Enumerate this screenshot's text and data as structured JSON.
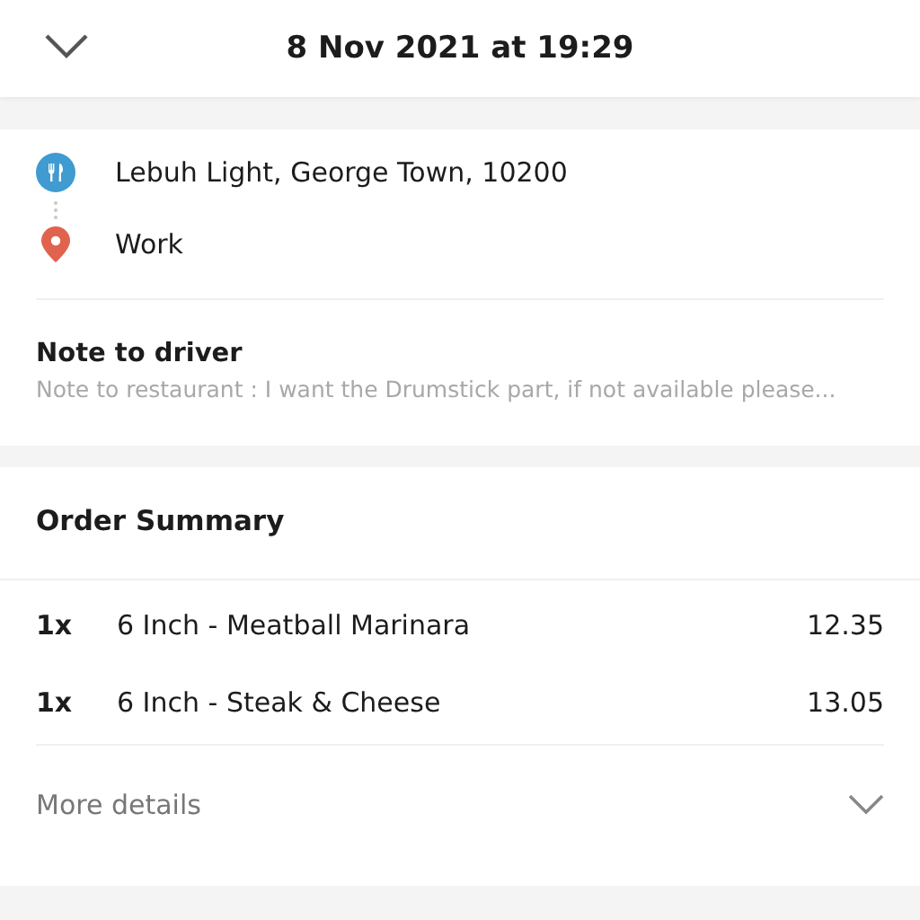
{
  "header": {
    "title": "8 Nov 2021 at 19:29"
  },
  "route": [
    {
      "kind": "restaurant",
      "label": "Lebuh Light, George Town, 10200"
    },
    {
      "kind": "destination",
      "label": "Work"
    }
  ],
  "note": {
    "title": "Note to driver",
    "text": "Note to restaurant : I want the Drumstick part, if not available please..."
  },
  "order_summary": {
    "title": "Order Summary",
    "items": [
      {
        "quantity": "1x",
        "name": "6 Inch - Meatball Marinara",
        "price": "12.35"
      },
      {
        "quantity": "1x",
        "name": "6 Inch - Steak & Cheese",
        "price": "13.05"
      }
    ],
    "more_details": "More details"
  }
}
